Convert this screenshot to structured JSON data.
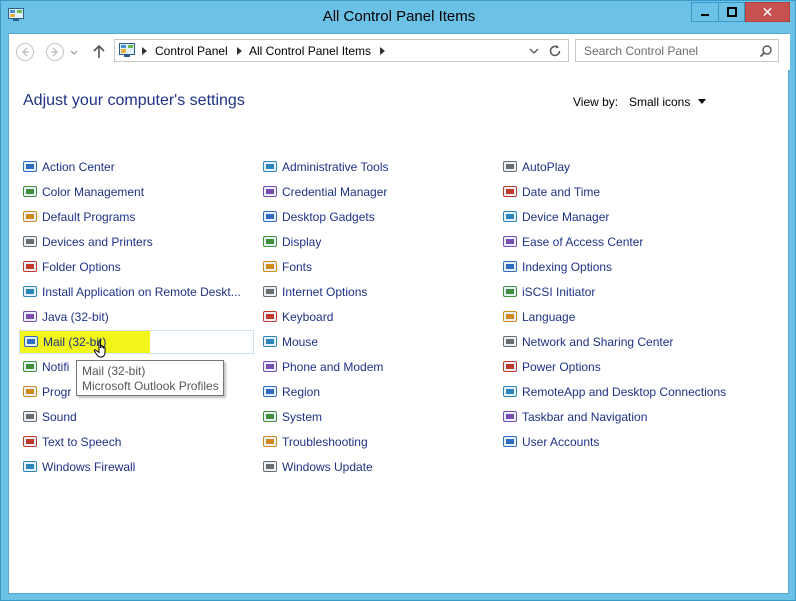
{
  "window": {
    "title": "All Control Panel Items",
    "accent_color": "#6cc1e6",
    "close_color": "#c7514f"
  },
  "nav": {
    "breadcrumb": [
      "Control Panel",
      "All Control Panel Items"
    ],
    "search_placeholder": "Search Control Panel"
  },
  "heading": "Adjust your computer's settings",
  "view_by": {
    "label": "View by:",
    "value": "Small icons"
  },
  "columns": [
    [
      {
        "label": "Action Center",
        "icon": "flag-icon"
      },
      {
        "label": "Color Management",
        "icon": "color-monitor-icon"
      },
      {
        "label": "Default Programs",
        "icon": "checklist-icon"
      },
      {
        "label": "Devices and Printers",
        "icon": "printer-icon"
      },
      {
        "label": "Folder Options",
        "icon": "folder-icon"
      },
      {
        "label": "Install Application on Remote Deskt...",
        "icon": "remote-install-icon"
      },
      {
        "label": "Java (32-bit)",
        "icon": "java-icon"
      },
      {
        "label": "Mail (32-bit)",
        "icon": "mail-icon"
      },
      {
        "label": "Notifi",
        "icon": "notification-icon"
      },
      {
        "label": "Progr",
        "icon": "programs-icon"
      },
      {
        "label": "Sound",
        "icon": "speaker-icon"
      },
      {
        "label": "Text to Speech",
        "icon": "speech-icon"
      },
      {
        "label": "Windows Firewall",
        "icon": "firewall-icon"
      }
    ],
    [
      {
        "label": "Administrative Tools",
        "icon": "gear-icon"
      },
      {
        "label": "Credential Manager",
        "icon": "vault-icon"
      },
      {
        "label": "Desktop Gadgets",
        "icon": "gadgets-icon"
      },
      {
        "label": "Display",
        "icon": "display-icon"
      },
      {
        "label": "Fonts",
        "icon": "fonts-icon"
      },
      {
        "label": "Internet Options",
        "icon": "globe-icon"
      },
      {
        "label": "Keyboard",
        "icon": "keyboard-icon"
      },
      {
        "label": "Mouse",
        "icon": "mouse-icon"
      },
      {
        "label": "Phone and Modem",
        "icon": "phone-icon"
      },
      {
        "label": "Region",
        "icon": "region-icon"
      },
      {
        "label": "System",
        "icon": "system-icon"
      },
      {
        "label": "Troubleshooting",
        "icon": "troubleshoot-icon"
      },
      {
        "label": "Windows Update",
        "icon": "update-icon"
      }
    ],
    [
      {
        "label": "AutoPlay",
        "icon": "autoplay-icon"
      },
      {
        "label": "Date and Time",
        "icon": "clock-icon"
      },
      {
        "label": "Device Manager",
        "icon": "device-manager-icon"
      },
      {
        "label": "Ease of Access Center",
        "icon": "ease-access-icon"
      },
      {
        "label": "Indexing Options",
        "icon": "indexing-icon"
      },
      {
        "label": "iSCSI Initiator",
        "icon": "iscsi-icon"
      },
      {
        "label": "Language",
        "icon": "language-icon"
      },
      {
        "label": "Network and Sharing Center",
        "icon": "network-icon"
      },
      {
        "label": "Power Options",
        "icon": "power-icon"
      },
      {
        "label": "RemoteApp and Desktop Connections",
        "icon": "remoteapp-icon"
      },
      {
        "label": "Taskbar and Navigation",
        "icon": "taskbar-icon"
      },
      {
        "label": "User Accounts",
        "icon": "users-icon"
      }
    ]
  ],
  "tooltip": {
    "line1": "Mail (32-bit)",
    "line2": "Microsoft Outlook Profiles"
  }
}
